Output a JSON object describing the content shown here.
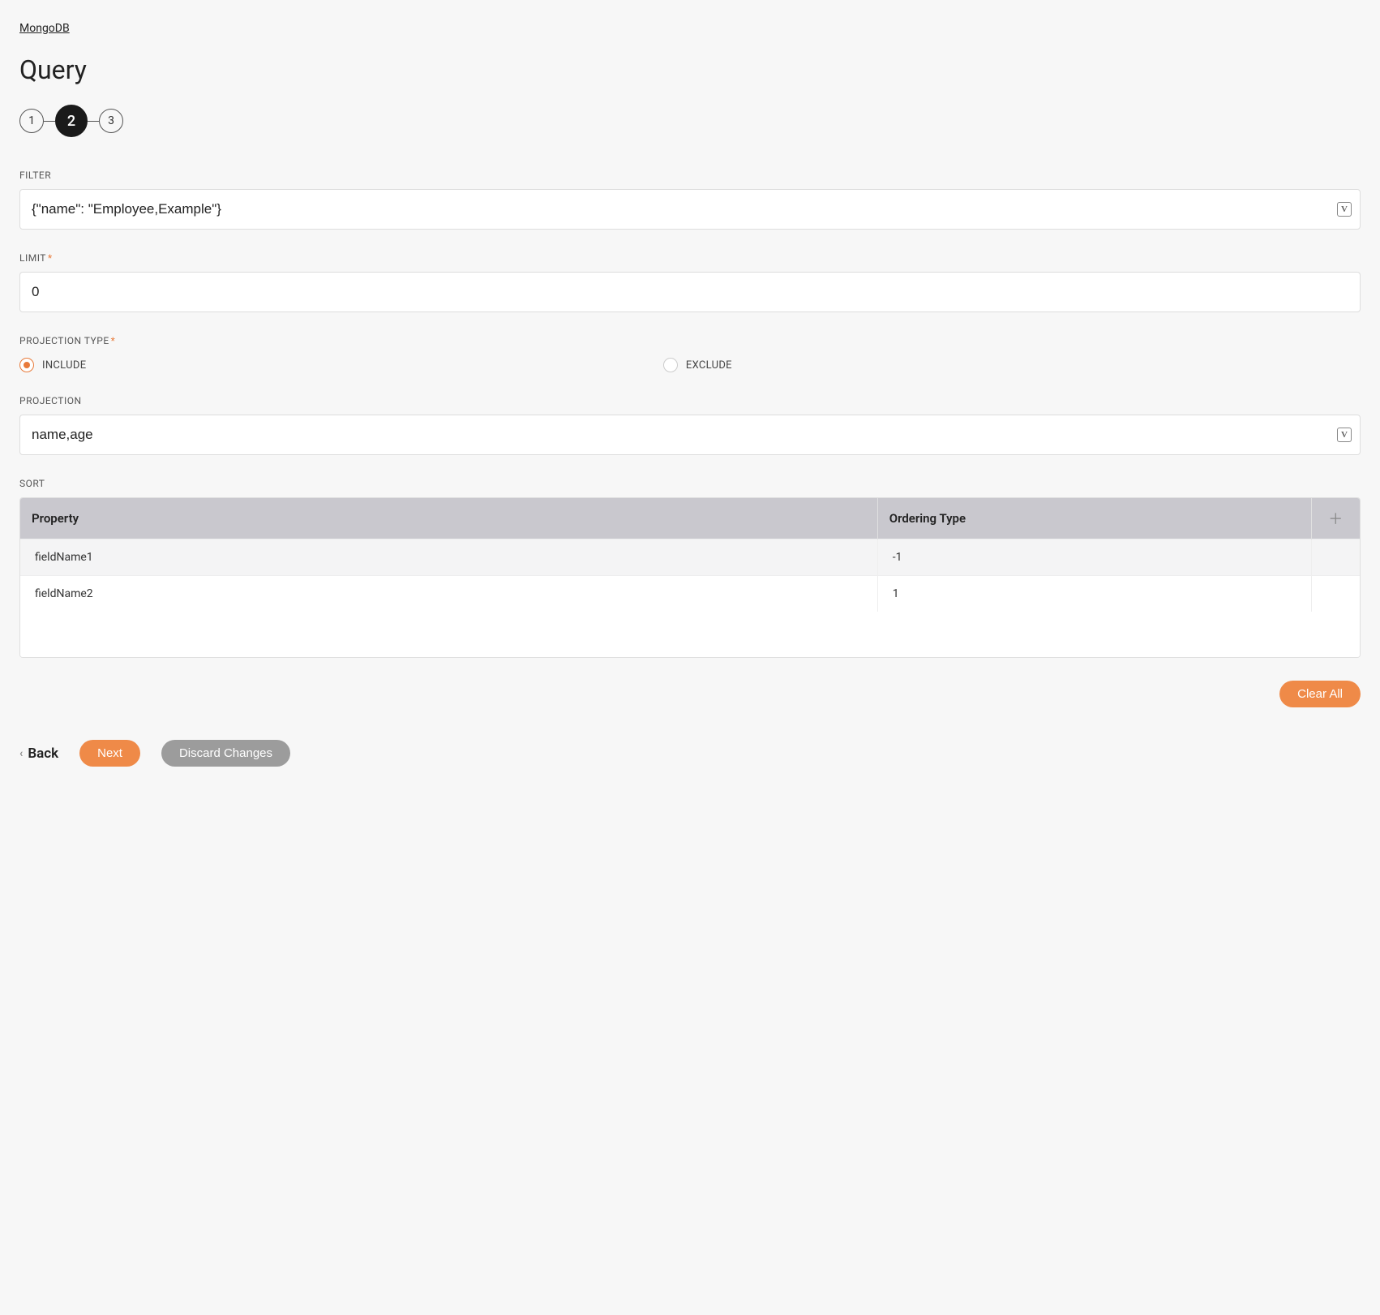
{
  "breadcrumb": "MongoDB",
  "page_title": "Query",
  "stepper": {
    "steps": [
      "1",
      "2",
      "3"
    ],
    "active_index": 1
  },
  "filter": {
    "label": "FILTER",
    "value": "{\"name\": \"Employee,Example\"}",
    "badge": "V"
  },
  "limit": {
    "label": "LIMIT",
    "required": true,
    "value": "0"
  },
  "projection_type": {
    "label": "PROJECTION TYPE",
    "required": true,
    "options": [
      {
        "label": "INCLUDE",
        "checked": true
      },
      {
        "label": "EXCLUDE",
        "checked": false
      }
    ]
  },
  "projection": {
    "label": "PROJECTION",
    "value": "name,age",
    "badge": "V"
  },
  "sort": {
    "label": "SORT",
    "columns": [
      "Property",
      "Ordering Type"
    ],
    "rows": [
      {
        "property": "fieldName1",
        "ordering": "-1"
      },
      {
        "property": "fieldName2",
        "ordering": "1"
      }
    ]
  },
  "actions": {
    "clear_all": "Clear All",
    "back": "Back",
    "next": "Next",
    "discard": "Discard Changes"
  }
}
